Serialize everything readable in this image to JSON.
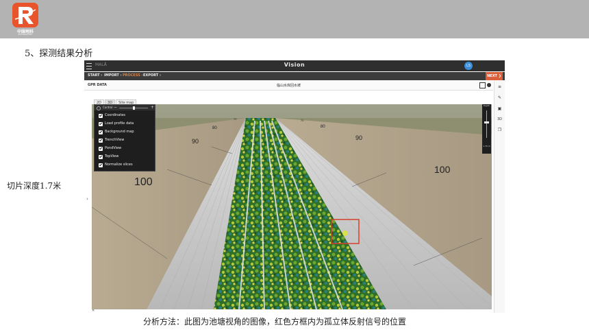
{
  "slide": {
    "section_title": "5、探测结果分析",
    "side_label": "切片深度1.7米",
    "caption": "分析方法：此图为池塘视角的图像，红色方框内为孤立体反射信号的位置",
    "logo": {
      "cn": "中国地科",
      "en": "ZHONGDIKE"
    },
    "topbar_color": "#b3b3b3",
    "logo_color": "#e8542b"
  },
  "app": {
    "brand": "MALÅ",
    "title": "Vision",
    "user_initials": "LS",
    "steps": [
      "START ›",
      "IMPORT ›",
      "PROCESS ›",
      "EXPORT ›"
    ],
    "active_step": "PROCESS ›",
    "next_label": "NEXT ❯",
    "panel_label": "GPR DATA",
    "file_name": "临山水库回水坡",
    "view_tabs": [
      "2D",
      "3D",
      "Site map"
    ],
    "active_view": "3D",
    "layer_panel": {
      "header": "Control",
      "items": [
        "Coordinates",
        "Load profile data",
        "Background map",
        "TrenchView",
        "PondView",
        "TopView",
        "Normalize slices"
      ],
      "all_checked": true
    },
    "depth_scale": {
      "top": "Depth",
      "bottom": "1.70\nm"
    },
    "rail_icons": [
      "list-icon",
      "pin-icon",
      "chart-icon",
      "3d-label-icon",
      "copy-icon"
    ],
    "rail_3d_label": "3D",
    "scene": {
      "labels": {
        "left_near": "100",
        "left_mid": "90",
        "left_far": "80",
        "left_farthest": "70",
        "right_near": "100",
        "right_mid": "90",
        "right_far": "80",
        "right_farthest": "70"
      },
      "highlight_color": "#d6402a",
      "ground_color": "#a89a82",
      "wall_color": "#c9c9c9",
      "signal_colors": [
        "#1f6b3a",
        "#4e9a2f",
        "#a8c93a",
        "#d9d24a",
        "#2a7f86"
      ]
    }
  }
}
